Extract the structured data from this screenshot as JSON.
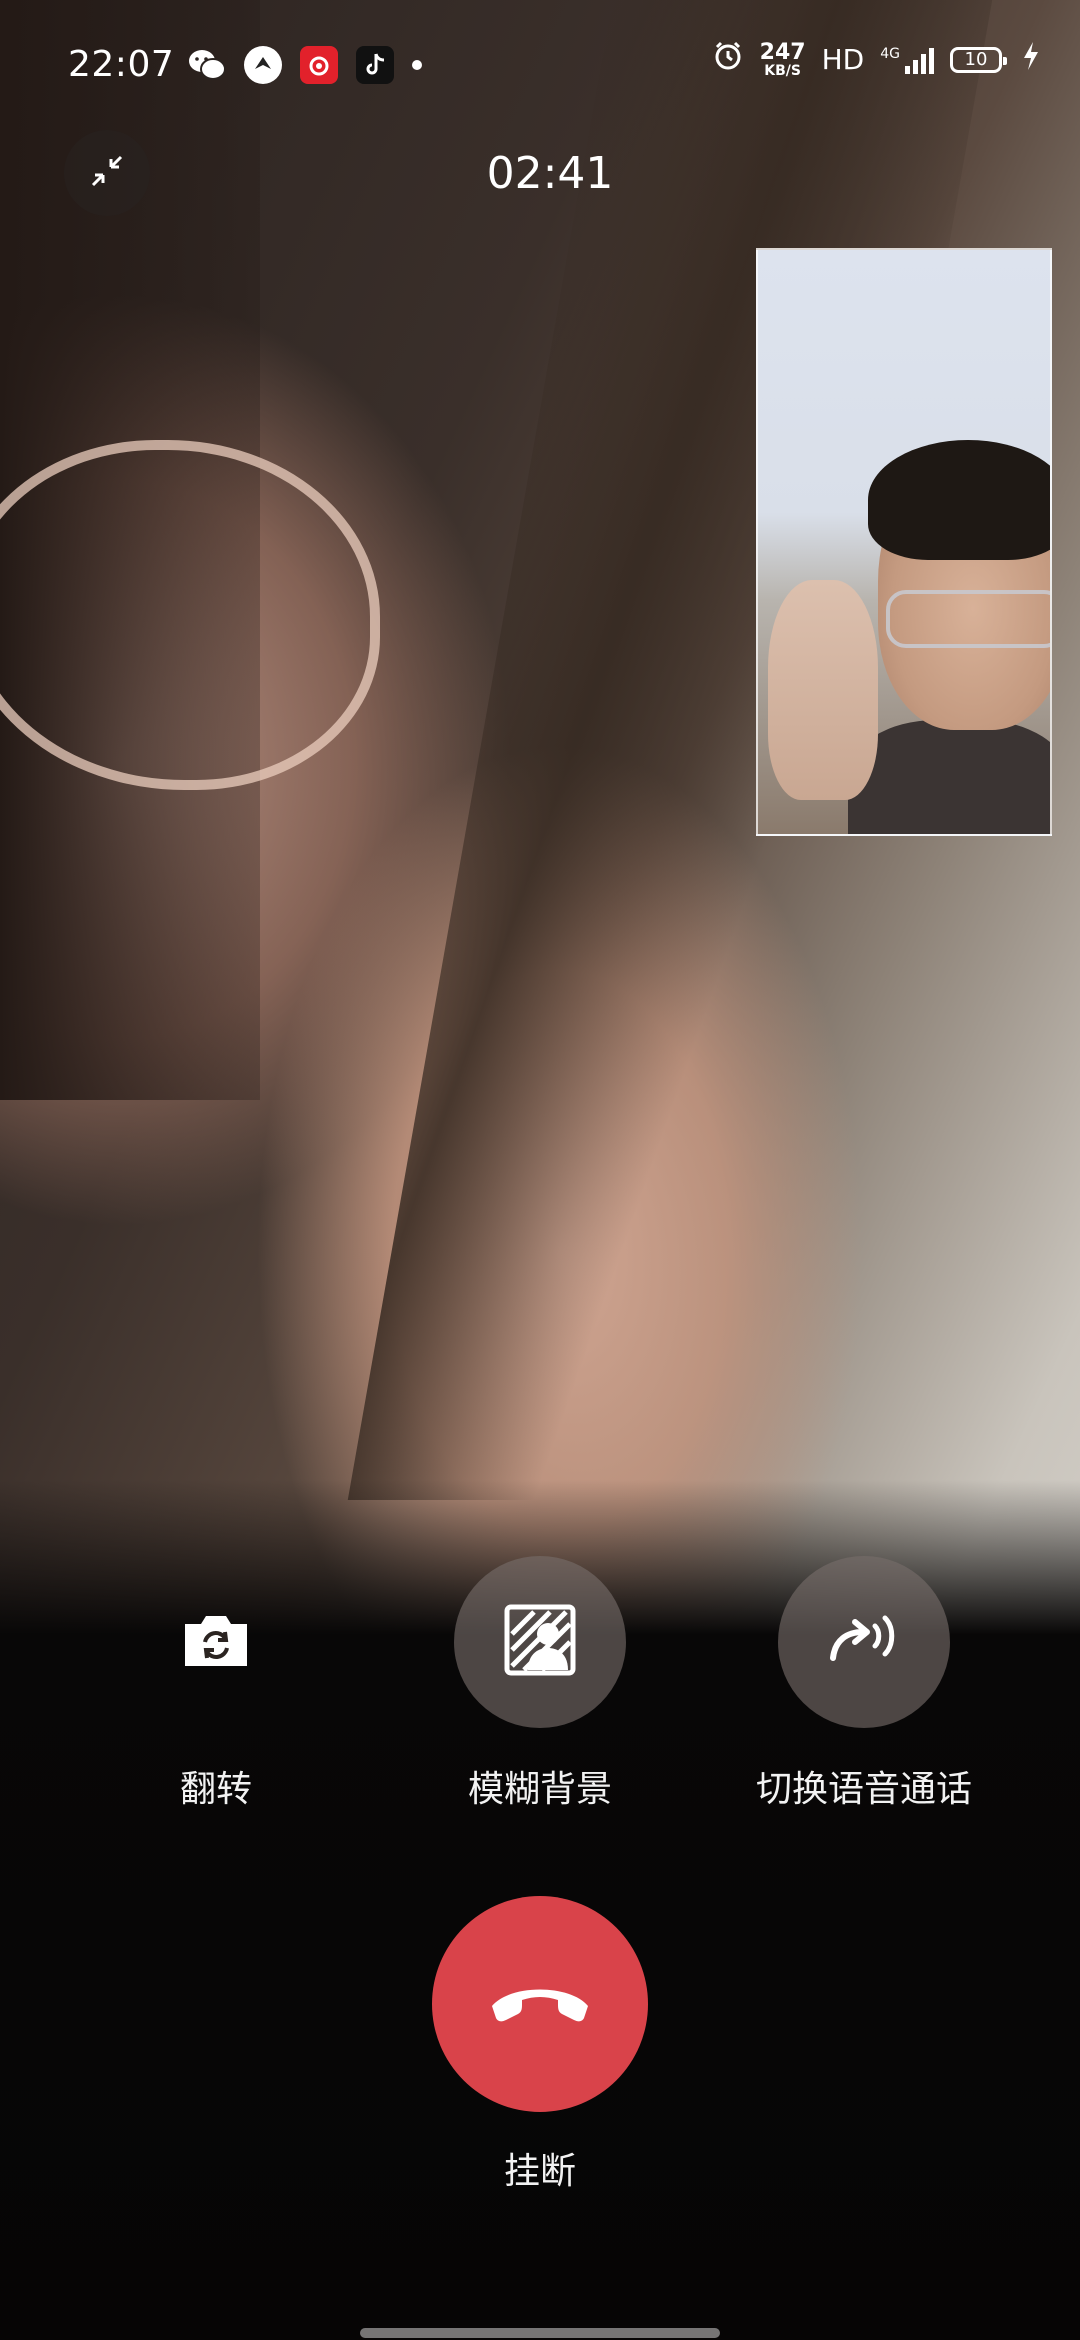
{
  "status_bar": {
    "time": "22:07",
    "notifications": {
      "wechat": "wechat-icon",
      "circle_app": "circle-app-icon",
      "netease_music": "netease-music-icon",
      "tiktok": "tiktok-icon"
    },
    "net_speed_value": "247",
    "net_speed_unit": "KB/S",
    "hd_label": "HD",
    "network_type": "4G",
    "battery_level": "10"
  },
  "call": {
    "timer": "02:41"
  },
  "controls": {
    "flip_label": "翻转",
    "blur_label": "模糊背景",
    "voice_label": "切换语音通话",
    "hangup_label": "挂断"
  },
  "colors": {
    "hangup": "#d9434a",
    "control_bg": "#786e6a"
  }
}
